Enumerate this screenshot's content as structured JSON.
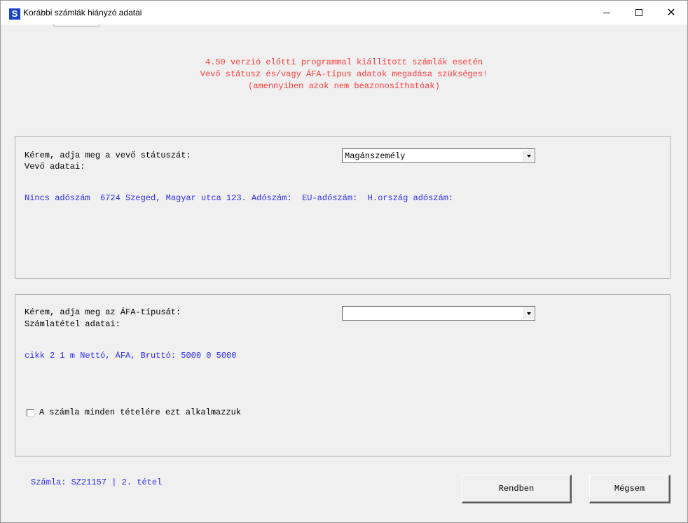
{
  "window": {
    "icon_glyph": "S",
    "title": "Korábbi számlák hiányzó adatai",
    "controls": {
      "minimize": "minimize-icon",
      "maximize": "maximize-icon",
      "close": "close-icon"
    }
  },
  "warning": {
    "line1": "4.50 verzió előtti programmal kiállított számlák esetén",
    "line2": "Vevő státusz és/vagy ÁFA-típus adatok megadása szükséges!",
    "line3": "(amennyiben azok nem beazonosíthatóak)",
    "color": "#ff3a3a"
  },
  "buyer": {
    "prompt": "Kérem, adja meg a vevő státuszát:",
    "data_label": "Vevő adatai:",
    "status_value": "Magánszemély",
    "details": "Nincs adószám  6724 Szeged, Magyar utca 123. Adószám:  EU-adószám:  H.ország adószám:"
  },
  "item": {
    "prompt": "Kérem, adja meg az ÁFA-típusát:",
    "data_label": "Számlatétel adatai:",
    "vat_value": "",
    "details": "cikk 2 1 m Nettó, ÁFA, Bruttó: 5000 0 5000",
    "apply_all_label": "A számla minden tételére ezt alkalmazzuk",
    "apply_all_checked": false
  },
  "footer": {
    "invoice_info": "Számla: SZ21157 | 2. tétel",
    "ok_label": "Rendben",
    "cancel_label": "Mégsem"
  },
  "colors": {
    "info_blue": "#2b2bf0",
    "background": "#f0f0f0"
  }
}
